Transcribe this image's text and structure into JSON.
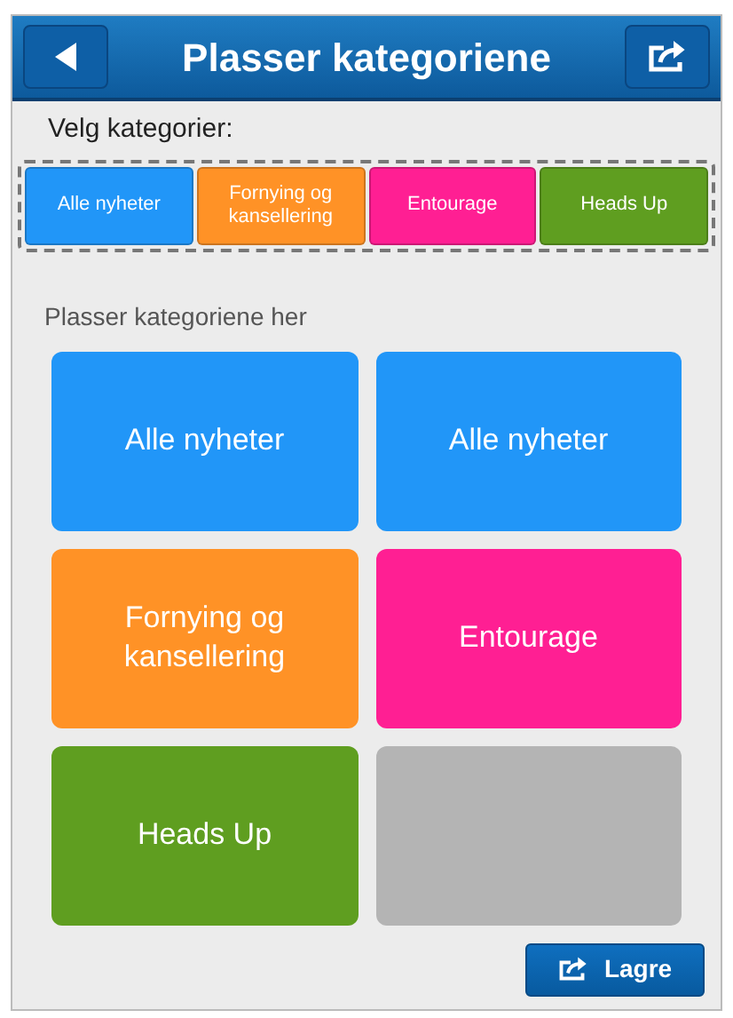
{
  "header": {
    "title": "Plasser kategoriene"
  },
  "picker": {
    "label": "Velg kategorier:",
    "items": [
      {
        "label": "Alle nyheter",
        "color": "#2196f8"
      },
      {
        "label": "Fornying og kansellering",
        "color": "#ff9226"
      },
      {
        "label": "Entourage",
        "color": "#ff1f93"
      },
      {
        "label": "Heads Up",
        "color": "#5f9e20"
      }
    ]
  },
  "board": {
    "label": "Plasser kategoriene her",
    "slots": [
      {
        "kind": "category",
        "label": "Alle nyheter",
        "color": "#2196f8"
      },
      {
        "kind": "category",
        "label": "Alle nyheter",
        "color": "#2196f8"
      },
      {
        "kind": "category",
        "label": "Fornying og kansellering",
        "color": "#ff9226"
      },
      {
        "kind": "category",
        "label": "Entourage",
        "color": "#ff1f93"
      },
      {
        "kind": "category",
        "label": "Heads Up",
        "color": "#5f9e20"
      },
      {
        "kind": "empty"
      }
    ]
  },
  "save_button": {
    "label": "Lagre"
  }
}
